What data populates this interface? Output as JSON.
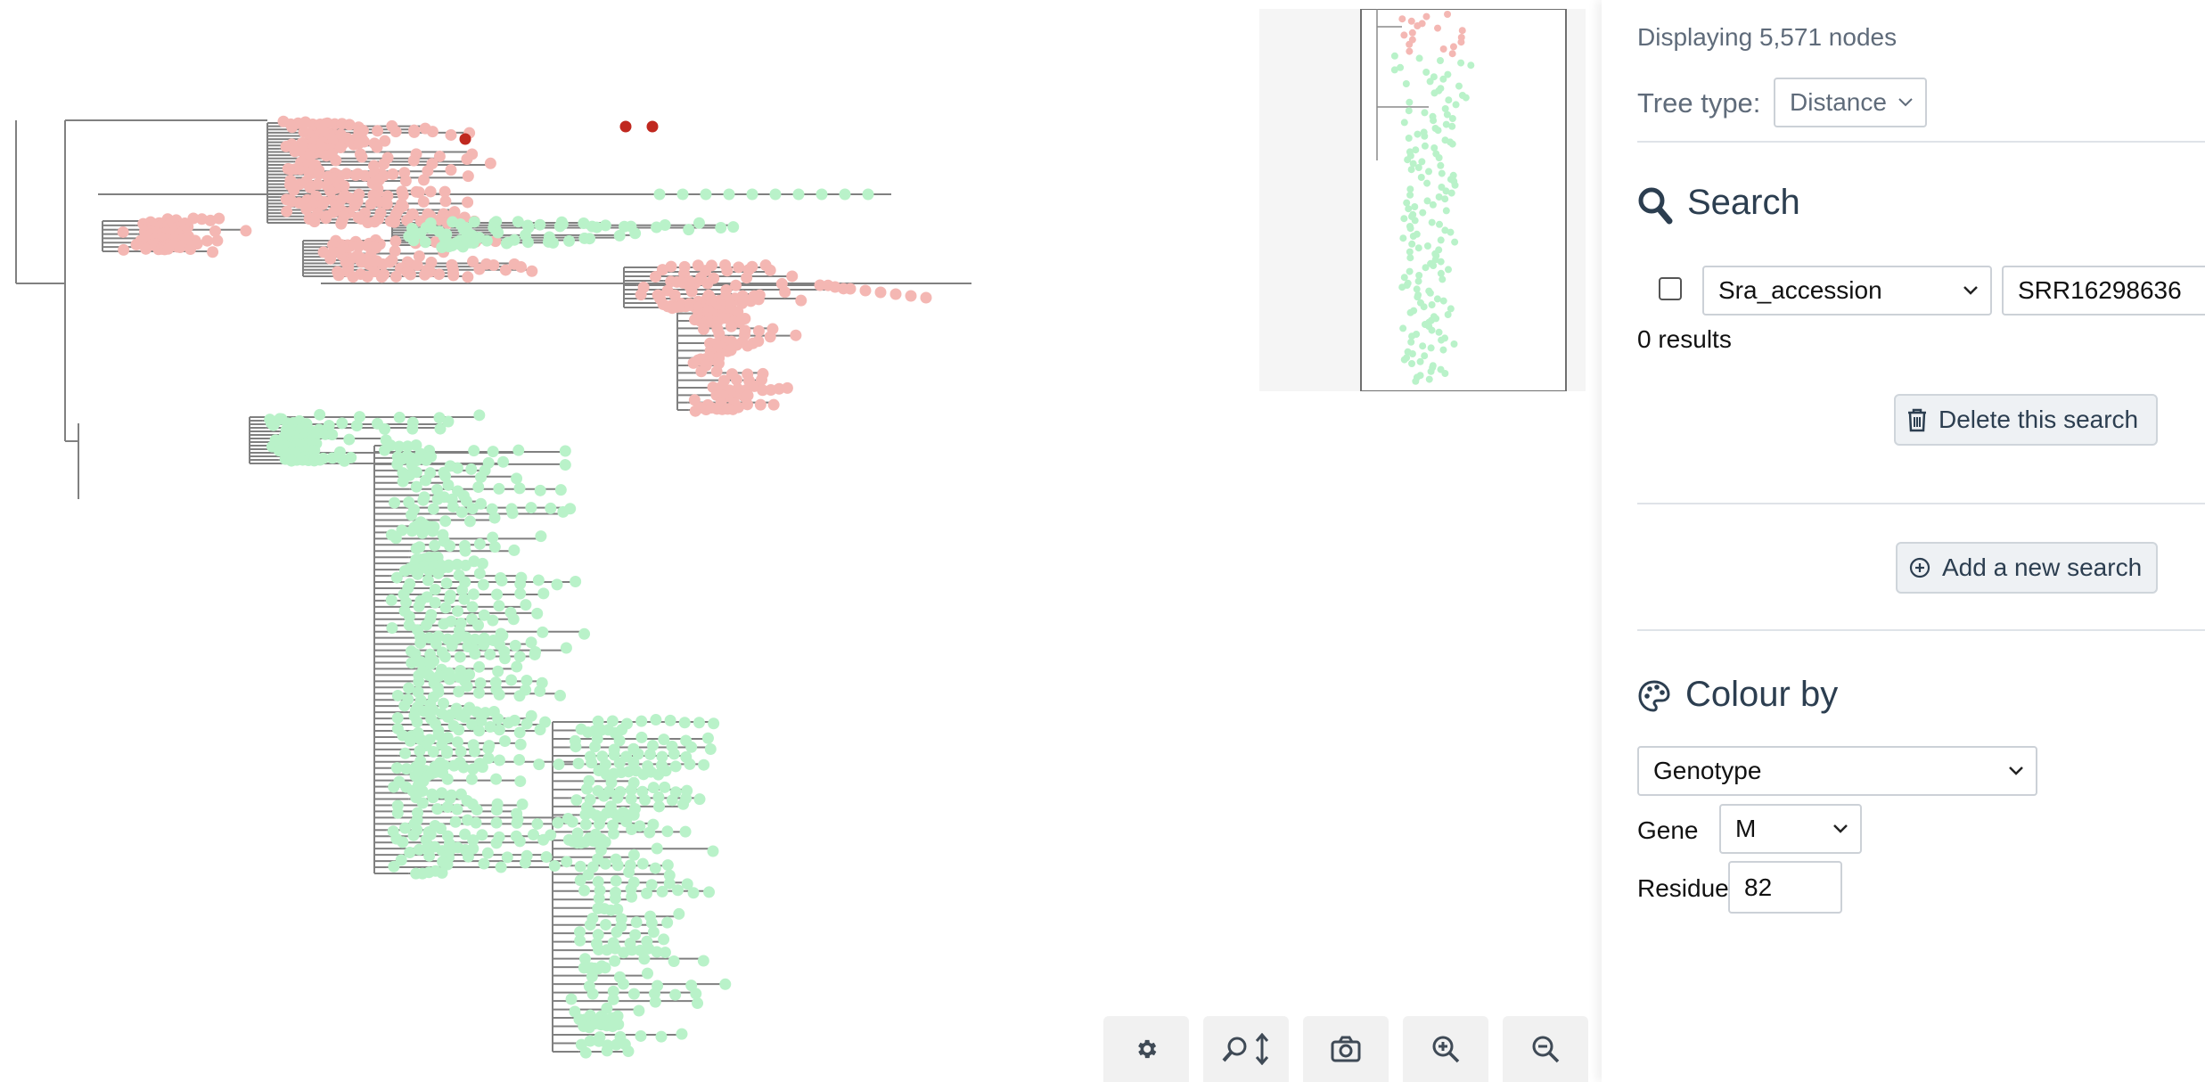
{
  "panel": {
    "node_count_text": "Displaying 5,571 nodes",
    "tree_type_label": "Tree type:",
    "tree_type_value": "Distance",
    "search_heading": "Search",
    "search_field_value": "Sra_accession",
    "search_input_value": "SRR16298636",
    "search_results_text": "0 results",
    "delete_search_label": "Delete this search",
    "add_search_label": "Add a new search",
    "colour_by_heading": "Colour by",
    "colour_by_value": "Genotype",
    "gene_label": "Gene",
    "gene_value": "M",
    "residue_label": "Residue",
    "residue_value": "82"
  },
  "toolbar": {
    "settings_icon": "gear-icon",
    "search_zoom_icon": "zoom-vertical-icon",
    "screenshot_icon": "camera-icon",
    "zoom_in_icon": "zoom-in-icon",
    "zoom_out_icon": "zoom-out-icon"
  },
  "colors": {
    "pink_node": "#f4b7b3",
    "green_node": "#b9f2c9",
    "highlight_node": "#c0281f",
    "branch": "#808080",
    "accent_text": "#2c3e50"
  }
}
